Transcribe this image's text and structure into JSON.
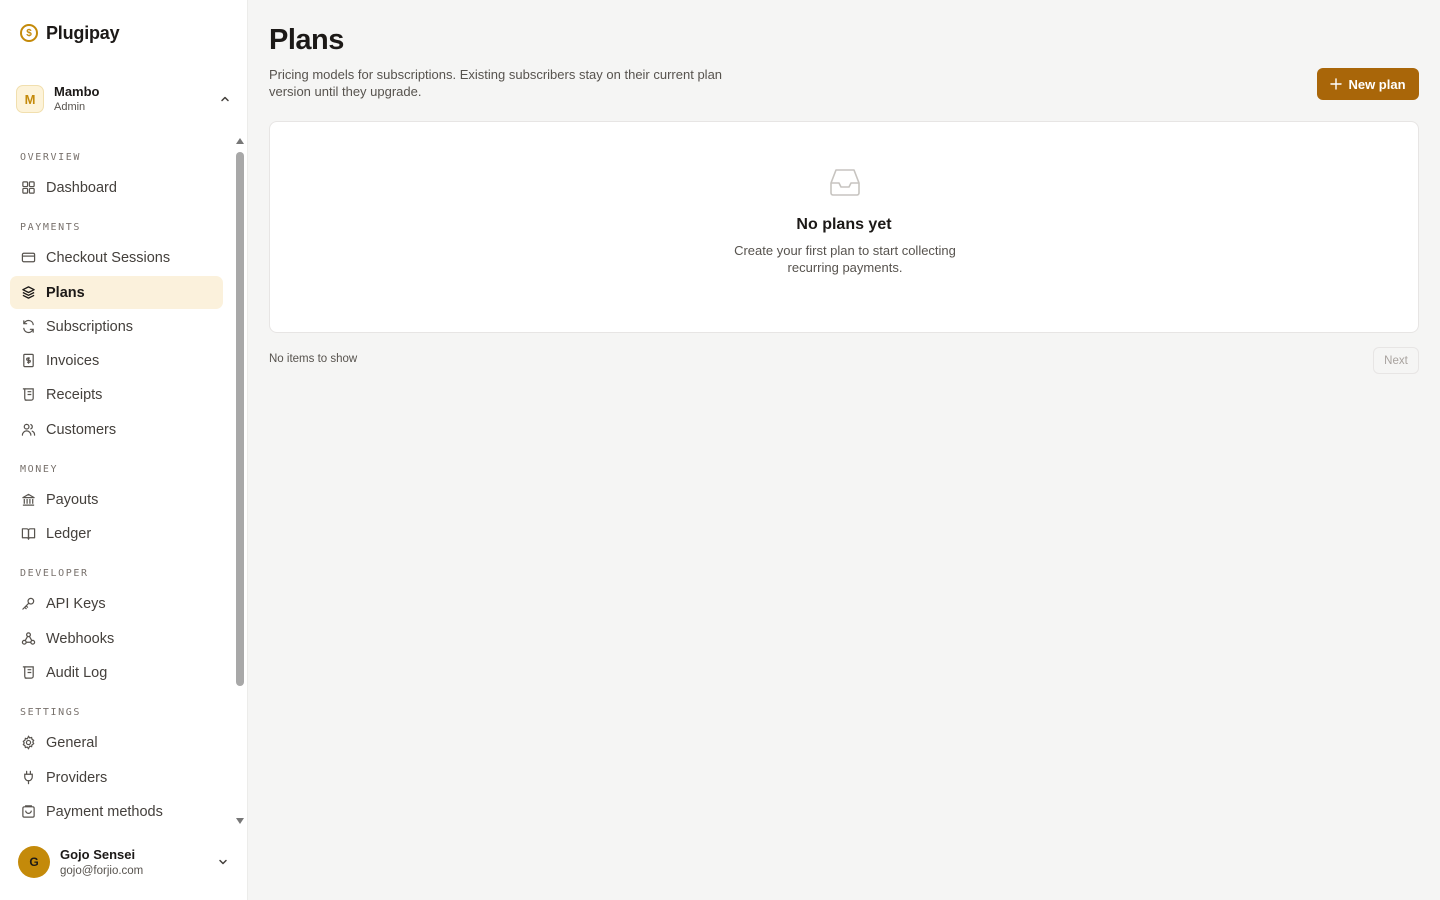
{
  "brand": {
    "name": "Plugipay",
    "logo_glyph": "$",
    "accent": "#c48a0a"
  },
  "org": {
    "initial": "M",
    "name": "Mambo",
    "role": "Admin"
  },
  "sidebar": {
    "sections": [
      {
        "label": "OVERVIEW",
        "items": [
          {
            "label": "Dashboard",
            "icon": "grid-icon"
          }
        ]
      },
      {
        "label": "PAYMENTS",
        "items": [
          {
            "label": "Checkout Sessions",
            "icon": "card-icon"
          },
          {
            "label": "Plans",
            "icon": "layers-icon",
            "active": true
          },
          {
            "label": "Subscriptions",
            "icon": "refresh-icon"
          },
          {
            "label": "Invoices",
            "icon": "invoice-icon"
          },
          {
            "label": "Receipts",
            "icon": "receipt-icon"
          },
          {
            "label": "Customers",
            "icon": "users-icon"
          }
        ]
      },
      {
        "label": "MONEY",
        "items": [
          {
            "label": "Payouts",
            "icon": "bank-icon"
          },
          {
            "label": "Ledger",
            "icon": "book-icon"
          }
        ]
      },
      {
        "label": "DEVELOPER",
        "items": [
          {
            "label": "API Keys",
            "icon": "key-icon"
          },
          {
            "label": "Webhooks",
            "icon": "webhook-icon"
          },
          {
            "label": "Audit Log",
            "icon": "scroll-icon"
          }
        ]
      },
      {
        "label": "SETTINGS",
        "items": [
          {
            "label": "General",
            "icon": "gear-icon"
          },
          {
            "label": "Providers",
            "icon": "plug-icon"
          },
          {
            "label": "Payment methods",
            "icon": "wallet-icon"
          }
        ]
      }
    ]
  },
  "user": {
    "initial": "G",
    "name": "Gojo Sensei",
    "email": "gojo@forjio.com"
  },
  "main": {
    "title": "Plans",
    "description": "Pricing models for subscriptions. Existing subscribers stay on their current plan version until they upgrade.",
    "new_button_label": "New plan",
    "empty_title": "No plans yet",
    "empty_description": "Create your first plan to start collecting recurring payments.",
    "pager_text": "No items to show",
    "next_label": "Next"
  }
}
